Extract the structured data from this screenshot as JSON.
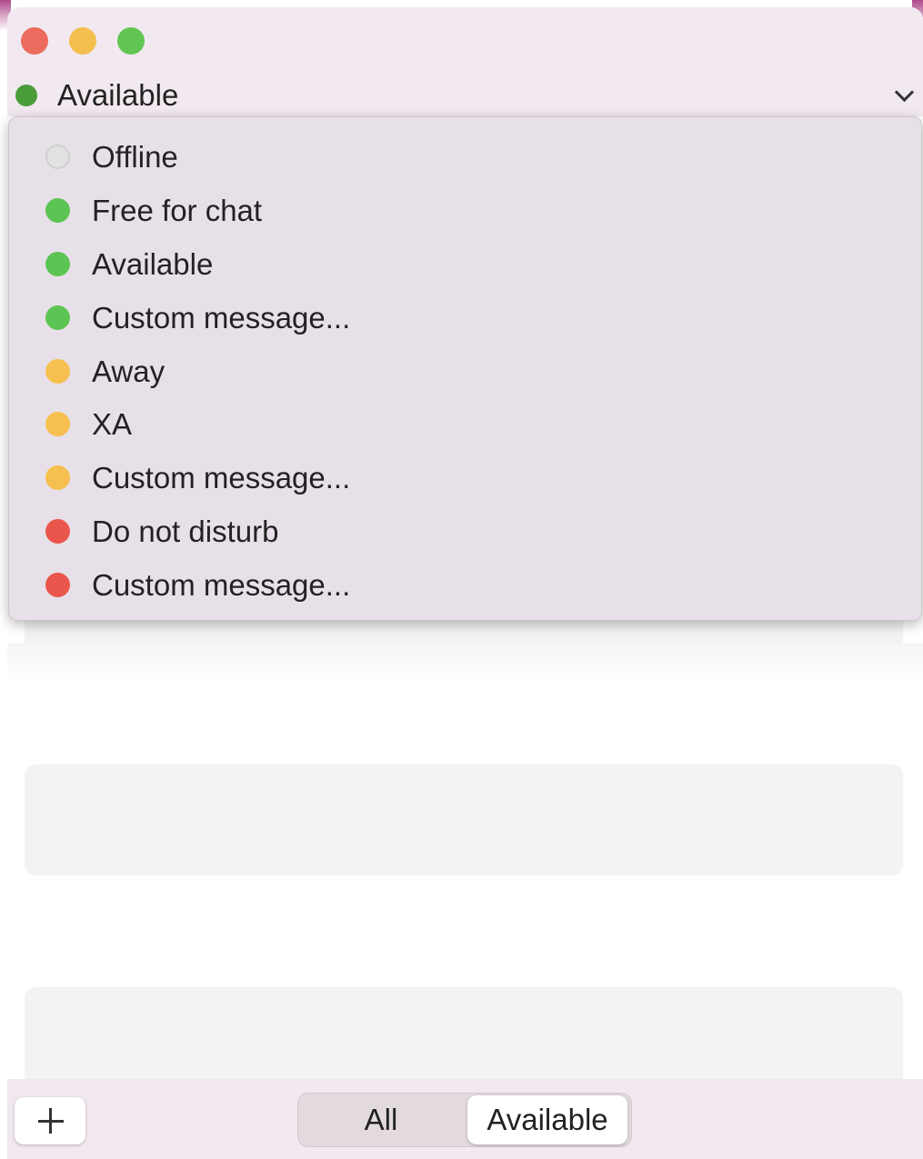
{
  "window": {
    "buttons": [
      {
        "name": "close",
        "color": "#ec6a5e"
      },
      {
        "name": "minimize",
        "color": "#f4bf4f"
      },
      {
        "name": "zoom",
        "color": "#61c554"
      }
    ]
  },
  "status": {
    "current_label": "Available",
    "current_color": "#4a9c3a"
  },
  "menu": {
    "items": [
      {
        "label": "Offline",
        "color": "#e2e2e2",
        "border": "#cfcfcf"
      },
      {
        "label": "Free for chat",
        "color": "#5cc453"
      },
      {
        "label": "Available",
        "color": "#5cc453"
      },
      {
        "label": "Custom message...",
        "color": "#5cc453"
      },
      {
        "label": "Away",
        "color": "#f6bf4f"
      },
      {
        "label": "XA",
        "color": "#f6bf4f"
      },
      {
        "label": "Custom message...",
        "color": "#f6bf4f"
      },
      {
        "label": "Do not disturb",
        "color": "#ea564b"
      },
      {
        "label": "Custom message...",
        "color": "#ea564b"
      }
    ]
  },
  "bottom": {
    "add_icon": "plus-icon",
    "filter": {
      "options": [
        "All",
        "Available"
      ],
      "selected": "Available"
    }
  }
}
